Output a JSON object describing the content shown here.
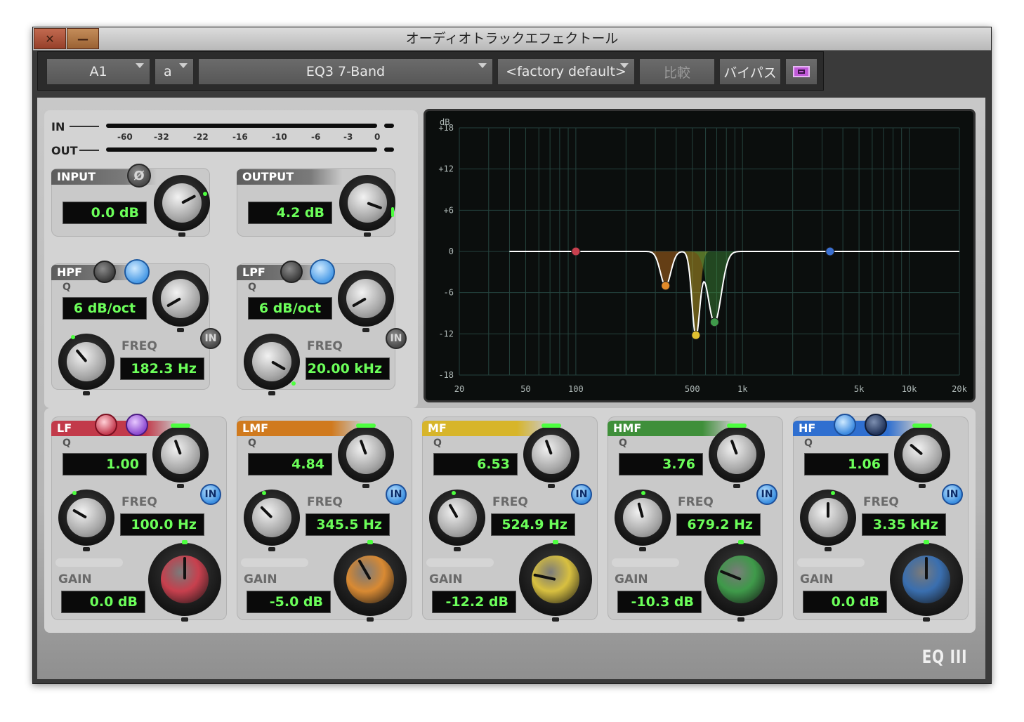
{
  "window": {
    "title": "オーディオトラックエフェクトール",
    "close_glyph": "✕",
    "min_glyph": "—"
  },
  "toolbar": {
    "track": "A1",
    "insert": "a",
    "plugin": "EQ3 7-Band",
    "preset": "<factory default>",
    "compare": "比較",
    "bypass": "バイパス"
  },
  "meters": {
    "in_label": "IN",
    "out_label": "OUT",
    "scale": [
      "-60",
      "-32",
      "-22",
      "-16",
      "-10",
      "-6",
      "-3",
      "0"
    ]
  },
  "input": {
    "label": "INPUT",
    "phase_glyph": "Ø",
    "value": "0.0 dB"
  },
  "output": {
    "label": "OUTPUT",
    "value": "4.2 dB"
  },
  "hpf": {
    "label": "HPF",
    "q_label": "Q",
    "slope": "6 dB/oct",
    "freq_label": "FREQ",
    "freq": "182.3 Hz",
    "in_label": "IN",
    "enabled": false
  },
  "lpf": {
    "label": "LPF",
    "q_label": "Q",
    "slope": "6 dB/oct",
    "freq_label": "FREQ",
    "freq": "20.00 kHz",
    "in_label": "IN",
    "enabled": false
  },
  "bands": [
    {
      "label": "LF",
      "q": "1.00",
      "freq": "100.0 Hz",
      "gain": "0.0 dB",
      "color": "#c23a4a",
      "knob": "#c8404e"
    },
    {
      "label": "LMF",
      "q": "4.84",
      "freq": "345.5 Hz",
      "gain": "-5.0 dB",
      "color": "#d07a1e",
      "knob": "#d98a33"
    },
    {
      "label": "MF",
      "q": "6.53",
      "freq": "524.9 Hz",
      "gain": "-12.2 dB",
      "color": "#d7b52a",
      "knob": "#d8c040"
    },
    {
      "label": "HMF",
      "q": "3.76",
      "freq": "679.2 Hz",
      "gain": "-10.3 dB",
      "color": "#3f8f3a",
      "knob": "#3f9a4a"
    },
    {
      "label": "HF",
      "q": "1.06",
      "freq": "3.35 kHz",
      "gain": "0.0 dB",
      "color": "#2f6fd0",
      "knob": "#3a6fb0"
    }
  ],
  "band_labels": {
    "q": "Q",
    "freq": "FREQ",
    "gain": "GAIN",
    "in": "IN"
  },
  "graph": {
    "db_label": "dB",
    "y_ticks": [
      "+18",
      "+12",
      "+6",
      "0",
      "-6",
      "-12",
      "-18"
    ],
    "x_ticks": [
      "20",
      "50",
      "100",
      "500",
      "1k",
      "5k",
      "10k",
      "20k"
    ]
  },
  "logo": "EQ III"
}
